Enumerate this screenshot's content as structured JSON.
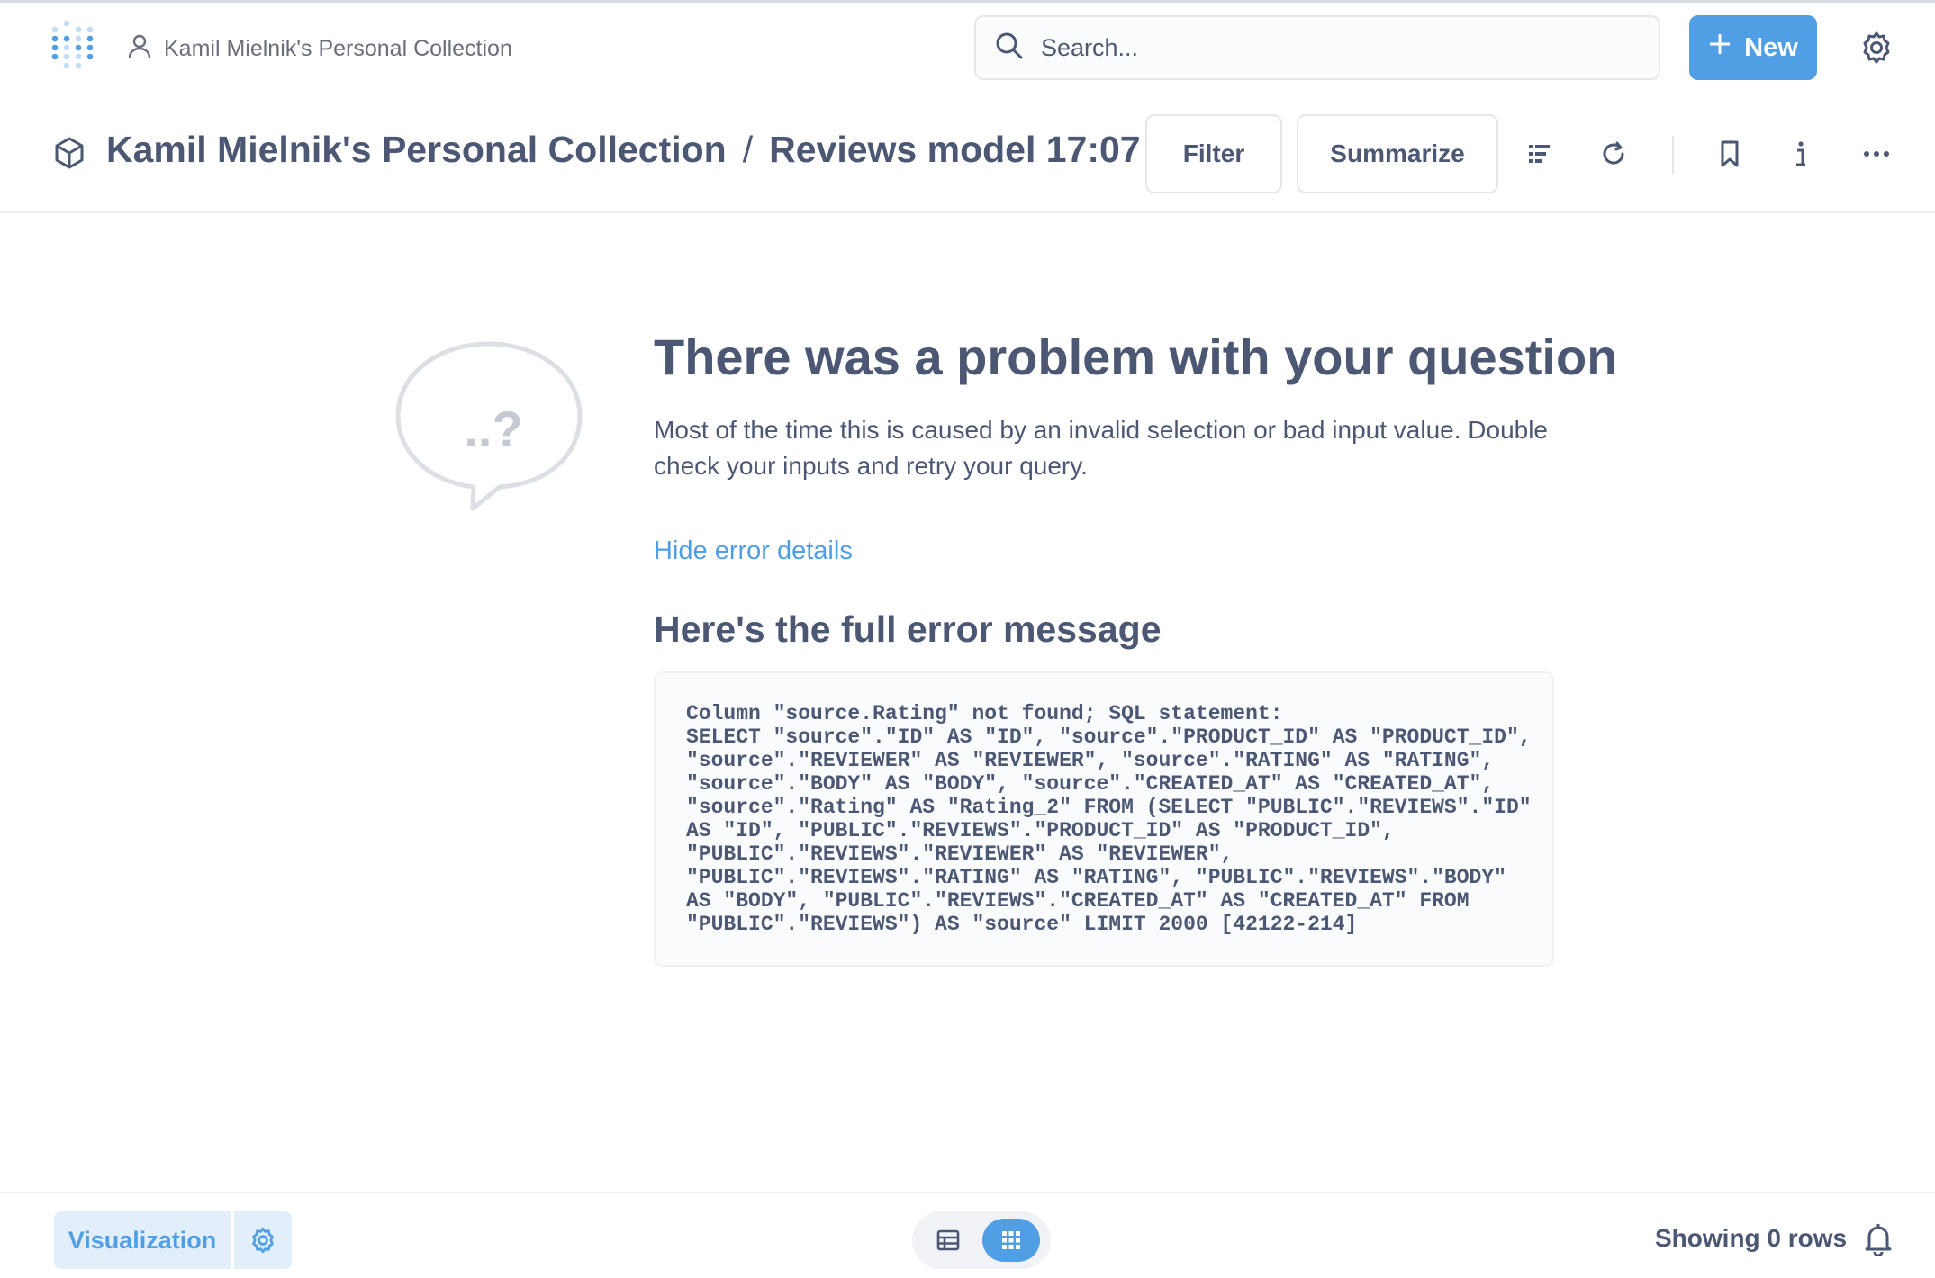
{
  "topnav": {
    "collection_label": "Kamil Mielnik's Personal Collection",
    "search_placeholder": "Search...",
    "new_label": "New"
  },
  "header": {
    "collection": "Kamil Mielnik's Personal Collection",
    "separator": "/",
    "question": "Reviews model 17:07",
    "filter_label": "Filter",
    "summarize_label": "Summarize"
  },
  "error": {
    "bubble_text": "..?",
    "title": "There was a problem with your question",
    "description": "Most of the time this is caused by an invalid selection or bad input value. Double check your inputs and retry your query.",
    "toggle_link": "Hide error details",
    "full_heading": "Here's the full error message",
    "message": "Column \"source.Rating\" not found; SQL statement:\nSELECT \"source\".\"ID\" AS \"ID\", \"source\".\"PRODUCT_ID\" AS \"PRODUCT_ID\",\n\"source\".\"REVIEWER\" AS \"REVIEWER\", \"source\".\"RATING\" AS \"RATING\",\n\"source\".\"BODY\" AS \"BODY\", \"source\".\"CREATED_AT\" AS \"CREATED_AT\",\n\"source\".\"Rating\" AS \"Rating_2\" FROM (SELECT \"PUBLIC\".\"REVIEWS\".\"ID\"\nAS \"ID\", \"PUBLIC\".\"REVIEWS\".\"PRODUCT_ID\" AS \"PRODUCT_ID\",\n\"PUBLIC\".\"REVIEWS\".\"REVIEWER\" AS \"REVIEWER\",\n\"PUBLIC\".\"REVIEWS\".\"RATING\" AS \"RATING\", \"PUBLIC\".\"REVIEWS\".\"BODY\"\nAS \"BODY\", \"PUBLIC\".\"REVIEWS\".\"CREATED_AT\" AS \"CREATED_AT\" FROM\n\"PUBLIC\".\"REVIEWS\") AS \"source\" LIMIT 2000 [42122-214]"
  },
  "footer": {
    "visualization_label": "Visualization",
    "rows_label": "Showing 0 rows"
  },
  "colors": {
    "brand": "#509ee3",
    "text": "#4c5773",
    "muted": "#696e7b",
    "border": "#e4e7ec"
  },
  "icons": [
    "metabase-logo-icon",
    "user-icon",
    "search-icon",
    "plus-icon",
    "gear-icon",
    "cube-icon",
    "list-icon",
    "refresh-icon",
    "bookmark-icon",
    "info-icon",
    "ellipsis-icon",
    "speech-bubble-icon",
    "table-icon",
    "grid-icon",
    "bell-icon"
  ]
}
